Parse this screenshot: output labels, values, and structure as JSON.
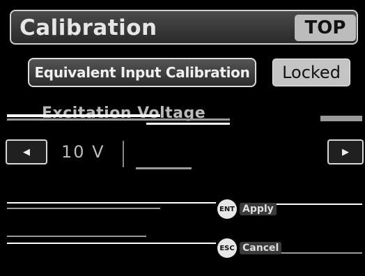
{
  "header": {
    "title": "Calibration",
    "top_button": "TOP"
  },
  "menu": {
    "equivalent_input_button": "Equivalent Input Calibration",
    "locked_button": "Locked"
  },
  "excitation": {
    "label": "Excitation Voltage",
    "value": "10 V"
  },
  "actions": {
    "ent": {
      "icon": "ENT",
      "label": "Apply"
    },
    "esc": {
      "icon": "ESC",
      "label": "Cancel"
    }
  },
  "colors": {
    "background": "#000000",
    "button_gray": "#bcbcbc",
    "text_light": "#e6e6e6"
  }
}
